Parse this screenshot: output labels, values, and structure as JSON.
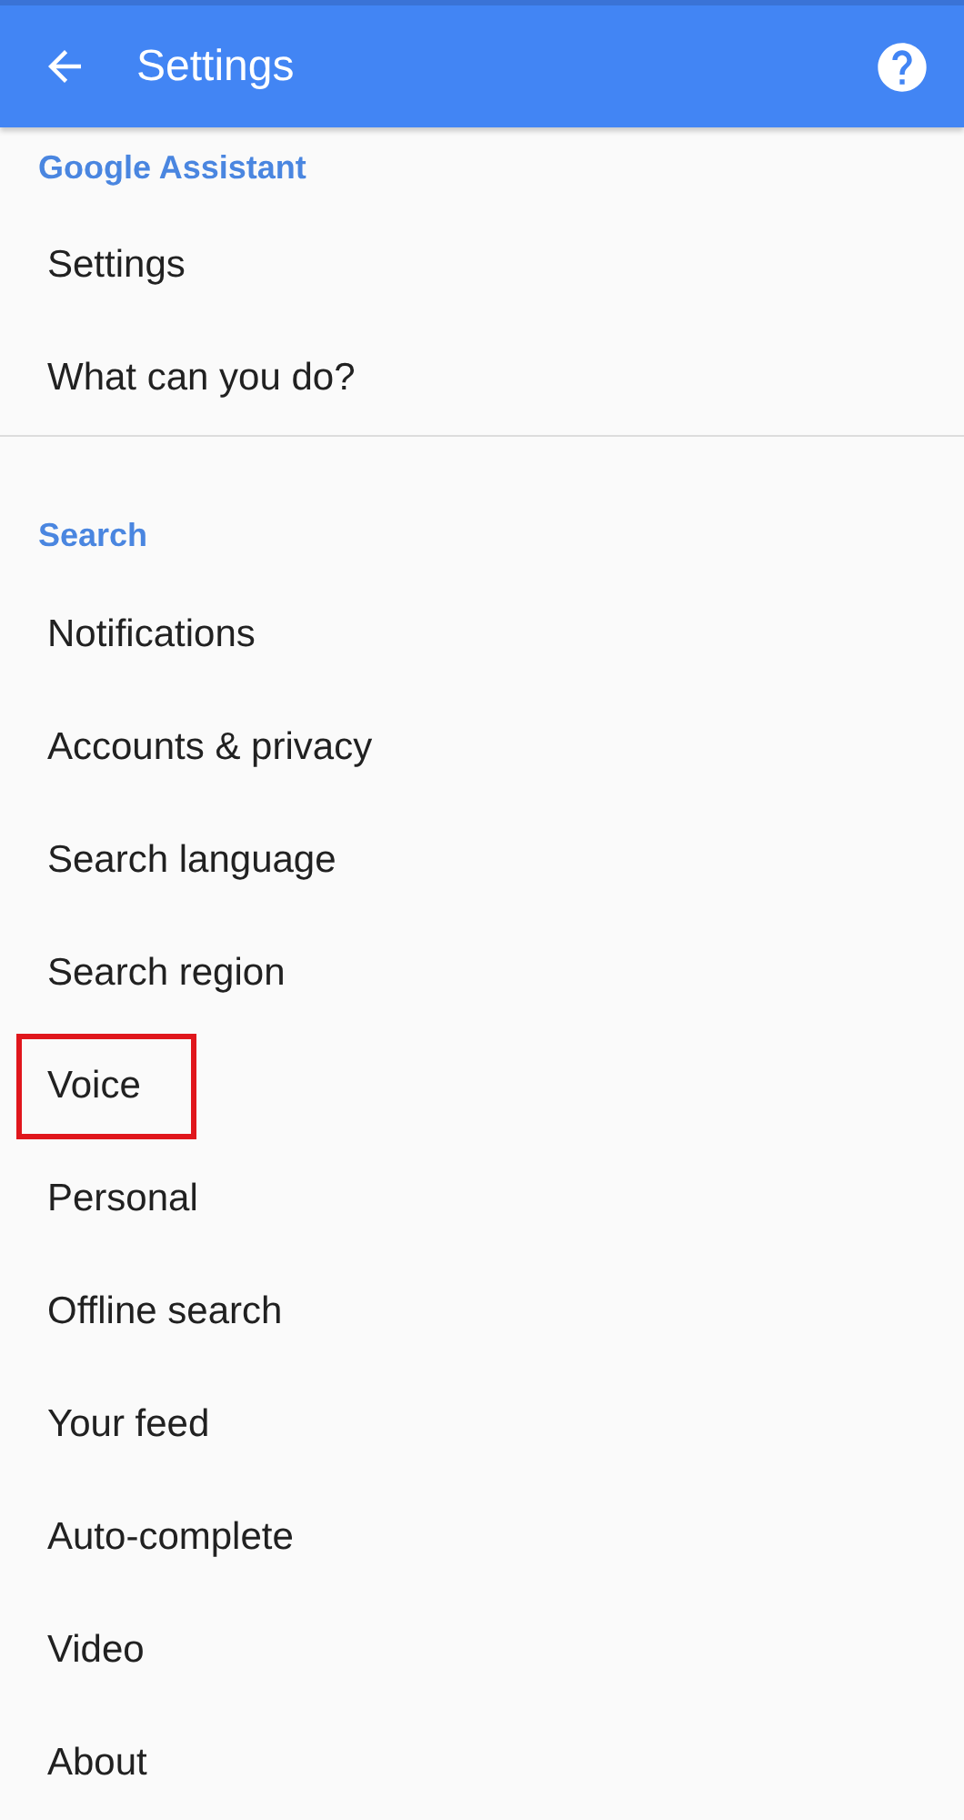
{
  "app_bar": {
    "title": "Settings"
  },
  "sections": [
    {
      "heading": "Google Assistant",
      "items": [
        {
          "label": "Settings",
          "highlighted": false
        },
        {
          "label": "What can you do?",
          "highlighted": false
        }
      ]
    },
    {
      "heading": "Search",
      "items": [
        {
          "label": "Notifications",
          "highlighted": false
        },
        {
          "label": "Accounts & privacy",
          "highlighted": false
        },
        {
          "label": "Search language",
          "highlighted": false
        },
        {
          "label": "Search region",
          "highlighted": false
        },
        {
          "label": "Voice",
          "highlighted": true
        },
        {
          "label": "Personal",
          "highlighted": false
        },
        {
          "label": "Offline search",
          "highlighted": false
        },
        {
          "label": "Your feed",
          "highlighted": false
        },
        {
          "label": "Auto-complete",
          "highlighted": false
        },
        {
          "label": "Video",
          "highlighted": false
        },
        {
          "label": "About",
          "highlighted": false
        }
      ]
    }
  ]
}
